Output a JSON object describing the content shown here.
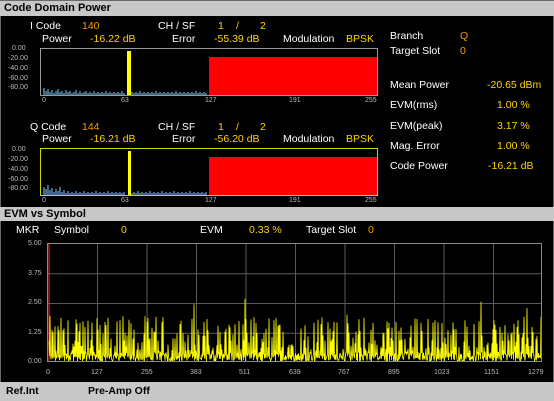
{
  "code_domain_power": {
    "title": "Code Domain Power",
    "i_channel": {
      "code_label": "I Code",
      "code_value": "140",
      "power_label": "Power",
      "power_value": "-16.22 dB",
      "chsf_label": "CH / SF",
      "ch_value": "1",
      "slash": "/",
      "sf_value": "2",
      "error_label": "Error",
      "error_value": "-55.39 dB",
      "modulation_label": "Modulation",
      "modulation_value": "BPSK",
      "y_ticks": [
        "0.00",
        "-20.00",
        "-40.00",
        "-60.00",
        "-80.00"
      ],
      "x_ticks": [
        "0",
        "63",
        "127",
        "191",
        "255"
      ]
    },
    "q_channel": {
      "code_label": "Q Code",
      "code_value": "144",
      "power_label": "Power",
      "power_value": "-16.21 dB",
      "chsf_label": "CH / SF",
      "ch_value": "1",
      "slash": "/",
      "sf_value": "2",
      "error_label": "Error",
      "error_value": "-56.20 dB",
      "modulation_label": "Modulation",
      "modulation_value": "BPSK",
      "y_ticks": [
        "0.00",
        "-20.00",
        "-40.00",
        "-60.00",
        "-80.00"
      ],
      "x_ticks": [
        "0",
        "63",
        "127",
        "191",
        "255"
      ]
    },
    "summary": {
      "branch_label": "Branch",
      "branch_value": "Q",
      "target_slot_label": "Target Slot",
      "target_slot_value": "0",
      "mean_power_label": "Mean Power",
      "mean_power_value": "-20.65 dBm",
      "evm_rms_label": "EVM(rms)",
      "evm_rms_value": "1.00 %",
      "evm_peak_label": "EVM(peak)",
      "evm_peak_value": "3.17 %",
      "mag_error_label": "Mag. Error",
      "mag_error_value": "1.00 %",
      "code_power_label": "Code Power",
      "code_power_value": "-16.21 dB"
    }
  },
  "evm_vs_symbol": {
    "title": "EVM vs Symbol",
    "mkr_label": "MKR",
    "symbol_label": "Symbol",
    "symbol_value": "0",
    "evm_label": "EVM",
    "evm_value": "0.33 %",
    "target_slot_label": "Target Slot",
    "target_slot_value": "0",
    "y_ticks": [
      "5.00",
      "3.75",
      "2.50",
      "1.25",
      "0.00"
    ],
    "x_ticks": [
      "0",
      "127",
      "255",
      "383",
      "511",
      "639",
      "767",
      "895",
      "1023",
      "1151",
      "1279"
    ]
  },
  "status_bar": {
    "ref": "Ref.Int",
    "preamp": "Pre-Amp Off"
  },
  "colors": {
    "trace": "#ffff00",
    "cdp_bar": "#7fd4ff",
    "active_code": "#ffff00",
    "inactive_block": "#ff0000",
    "value": "#ffd400",
    "code_value": "#ff9900"
  }
}
